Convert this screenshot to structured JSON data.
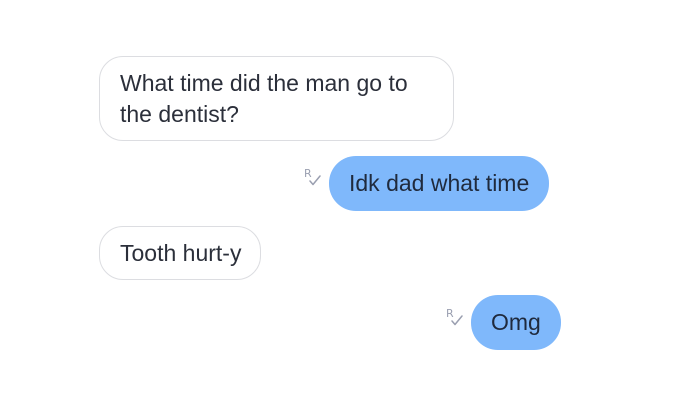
{
  "messages": [
    {
      "sender": "other",
      "text": "What time did the man go to the dentist?"
    },
    {
      "sender": "me",
      "text": "Idk dad what time",
      "receipt": "read-receipt-icon"
    },
    {
      "sender": "other",
      "text": "Tooth hurt-y"
    },
    {
      "sender": "me",
      "text": "Omg",
      "receipt": "read-receipt-icon"
    }
  ],
  "colors": {
    "background": "#ffffff",
    "incoming_bubble": "#ffffff",
    "incoming_border": "#dcdde1",
    "outgoing_bubble": "#7fb8fb",
    "text": "#2b2f3a",
    "receipt": "#9a9fb0"
  }
}
